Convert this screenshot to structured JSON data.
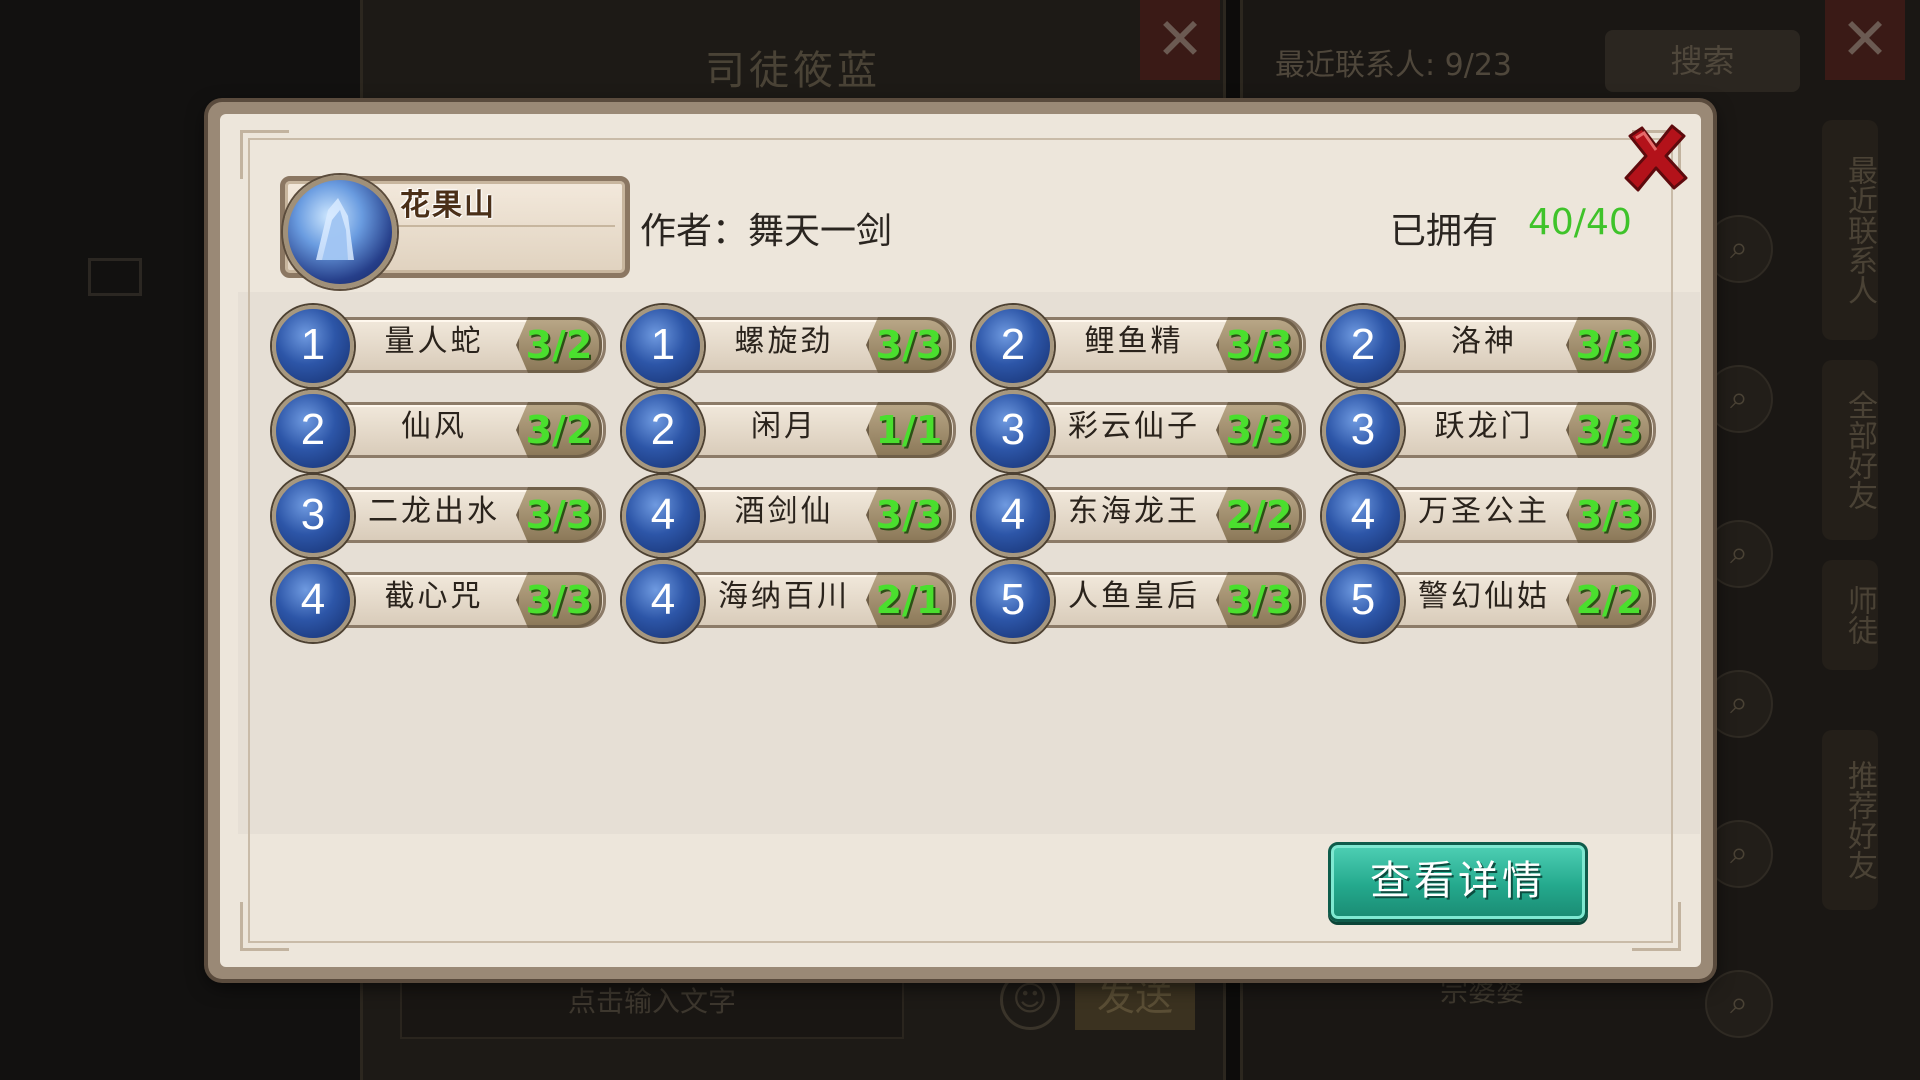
{
  "background": {
    "chat_title": "司徒筱蓝",
    "contacts_label": "最近联系人: 9/23",
    "search_button": "搜索",
    "side_tabs": [
      "最近联系人",
      "全部好友",
      "师徒",
      "推荐好友"
    ],
    "input_placeholder": "点击输入文字",
    "send_button": "发送",
    "bottom_name": "宗婆婆"
  },
  "dialog": {
    "scene_name": "花果山",
    "author": "作者：舞天一剑",
    "owned_label": "已拥有",
    "owned_value": "40/40",
    "details_button": "查看详情",
    "cards": [
      {
        "level": "1",
        "name": "量人蛇",
        "count": "3/2"
      },
      {
        "level": "1",
        "name": "螺旋劲",
        "count": "3/3"
      },
      {
        "level": "2",
        "name": "鲤鱼精",
        "count": "3/3"
      },
      {
        "level": "2",
        "name": "洛神",
        "count": "3/3"
      },
      {
        "level": "2",
        "name": "仙风",
        "count": "3/2"
      },
      {
        "level": "2",
        "name": "闲月",
        "count": "1/1"
      },
      {
        "level": "3",
        "name": "彩云仙子",
        "count": "3/3"
      },
      {
        "level": "3",
        "name": "跃龙门",
        "count": "3/3"
      },
      {
        "level": "3",
        "name": "二龙出水",
        "count": "3/3"
      },
      {
        "level": "4",
        "name": "酒剑仙",
        "count": "3/3"
      },
      {
        "level": "4",
        "name": "东海龙王",
        "count": "2/2"
      },
      {
        "level": "4",
        "name": "万圣公主",
        "count": "3/3"
      },
      {
        "level": "4",
        "name": "截心咒",
        "count": "3/3"
      },
      {
        "level": "4",
        "name": "海纳百川",
        "count": "2/1"
      },
      {
        "level": "5",
        "name": "人鱼皇后",
        "count": "3/3"
      },
      {
        "level": "5",
        "name": "警幻仙姑",
        "count": "2/2"
      }
    ]
  },
  "colors": {
    "owned_value": "#3fc32a",
    "count_text": "#4adf2e",
    "details_button": "#24a98d",
    "close_x": "#b3121a"
  },
  "icons": {
    "close": "close-icon",
    "scene_emblem": "mountain-emblem-icon",
    "mail": "mail-icon",
    "smiley": "smiley-icon",
    "search": "search-icon"
  }
}
